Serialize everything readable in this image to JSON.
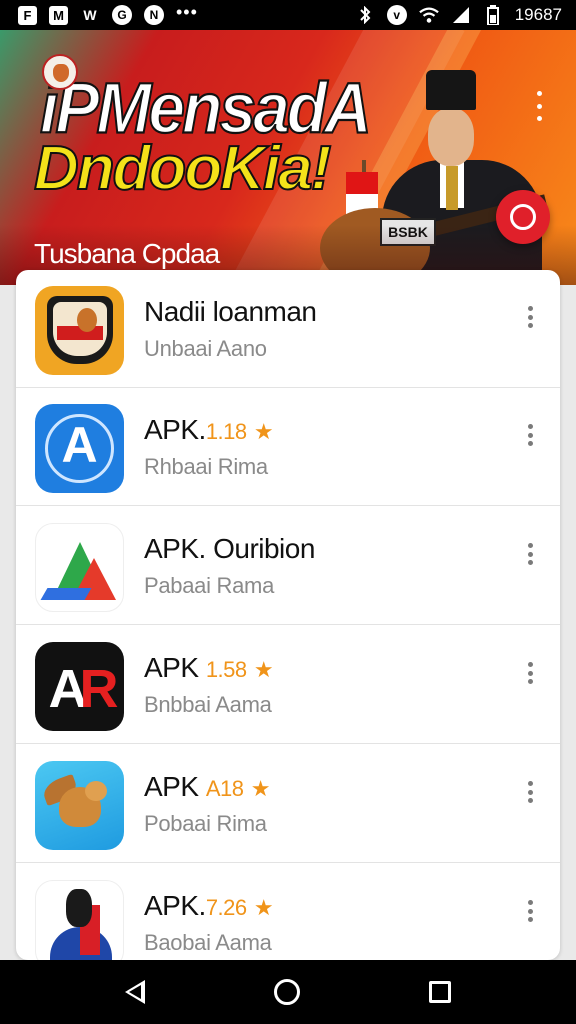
{
  "status_bar": {
    "left_icons": [
      "F",
      "M",
      "W",
      "G",
      "N"
    ],
    "more": "•••",
    "right_icons": [
      "bluetooth-icon",
      "v",
      "wifi-icon",
      "signal-icon",
      "battery-icon"
    ],
    "time": "19687"
  },
  "banner": {
    "title_line1": "iPMensadA",
    "title_line2": "DndooKia!",
    "subtitle": "Tusbana Cpdaa",
    "sign_text": "BSBK"
  },
  "apps": [
    {
      "name": "Nadii loanman",
      "version": "",
      "sub": "Unbaai Aano",
      "icon": "shield-badge-icon"
    },
    {
      "name": "APK.",
      "version": "1.18",
      "sub": "Rhbaai Rima",
      "icon": "blue-a-logo-icon"
    },
    {
      "name": "APK. Ouribion",
      "version": "",
      "sub": "Pabaai Rama",
      "icon": "triangle-logo-icon"
    },
    {
      "name": "APK",
      "version": "1.58",
      "sub": "Bnbbai Aama",
      "icon": "ar-logo-icon"
    },
    {
      "name": "APK",
      "version": "A18",
      "sub": "Pobaai Rima",
      "icon": "bird-logo-icon"
    },
    {
      "name": "APK.",
      "version": "7.26",
      "sub": "Baobai Aama",
      "icon": "person-logo-icon"
    }
  ],
  "colors": {
    "accent_star": "#f0941a",
    "fab": "#e0202a"
  }
}
